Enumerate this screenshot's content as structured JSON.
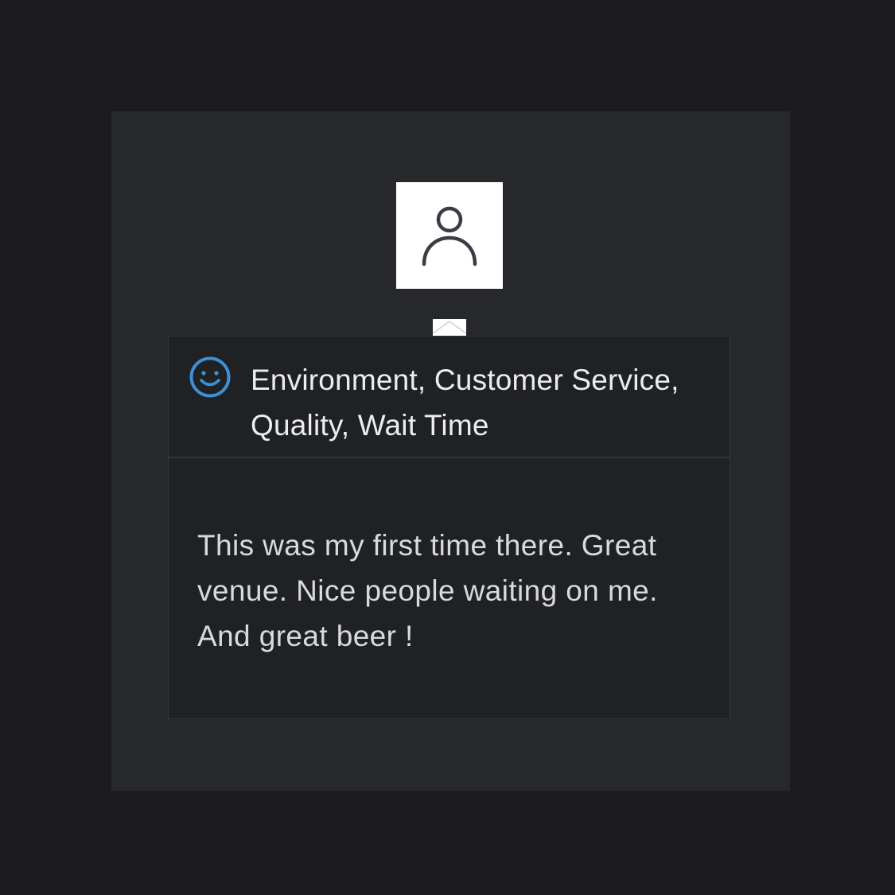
{
  "avatar": {
    "icon": "user-icon"
  },
  "review_card": {
    "sentiment_icon": "smiley-face-icon",
    "tags_text": "Environment, Customer Service, Quality, Wait Time",
    "review_text": "This was my first time there. Great venue. Nice people waiting on me. And great beer !"
  },
  "colors": {
    "page_background": "#1c1c1e",
    "panel_background": "#27282b",
    "card_background": "#202124",
    "accent_blue": "#3f8fd2",
    "text_primary": "#ecedf0"
  }
}
